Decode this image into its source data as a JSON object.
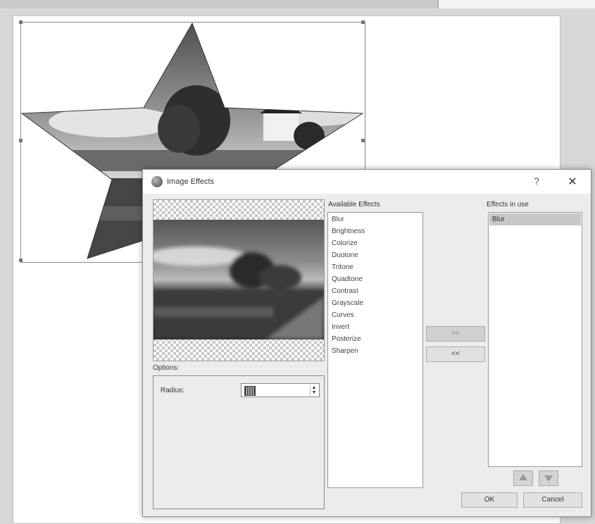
{
  "dialog": {
    "title": "Image Effects",
    "help_label": "?",
    "close_label": "✕",
    "icon": "image-effects-icon"
  },
  "options": {
    "label": "Options:",
    "radius_label": "Radius:",
    "radius_value": ""
  },
  "available": {
    "label": "Available Effects",
    "items": [
      "Blur",
      "Brightness",
      "Colorize",
      "Duotone",
      "Tritone",
      "Quadtone",
      "Contrast",
      "Grayscale",
      "Curves",
      "Invert",
      "Posterize",
      "Sharpen"
    ]
  },
  "in_use": {
    "label": "Effects in use",
    "items": [
      "Blur"
    ]
  },
  "buttons": {
    "add": ">>",
    "remove": "<<",
    "ok": "OK",
    "cancel": "Cancel"
  },
  "colors": {
    "dialog_bg": "#ececec",
    "selected_row": "#c7c7c7"
  }
}
